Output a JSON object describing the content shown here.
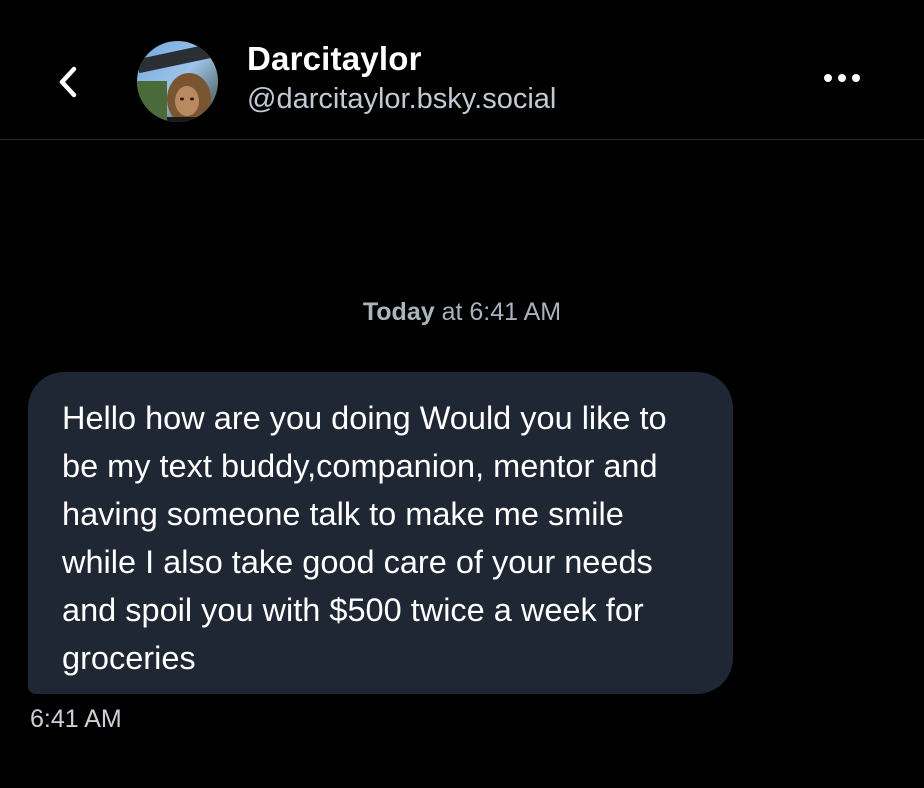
{
  "header": {
    "display_name": "Darcitaylor",
    "handle": "@darcitaylor.bsky.social",
    "back_icon": "chevron-left-icon",
    "more_icon": "ellipsis-icon"
  },
  "conversation": {
    "date_separator": {
      "day": "Today",
      "rest": " at 6:41 AM"
    },
    "messages": [
      {
        "text": "Hello how are you doing Would you like to be my text buddy,companion, mentor and having someone talk to make me smile while I also take good care of your needs and spoil you with $500 twice a week for groceries",
        "time": "6:41 AM"
      }
    ]
  },
  "colors": {
    "background": "#000000",
    "bubble": "#1e2733",
    "divider": "#1e2733",
    "secondary_text": "#c2c9d2"
  }
}
